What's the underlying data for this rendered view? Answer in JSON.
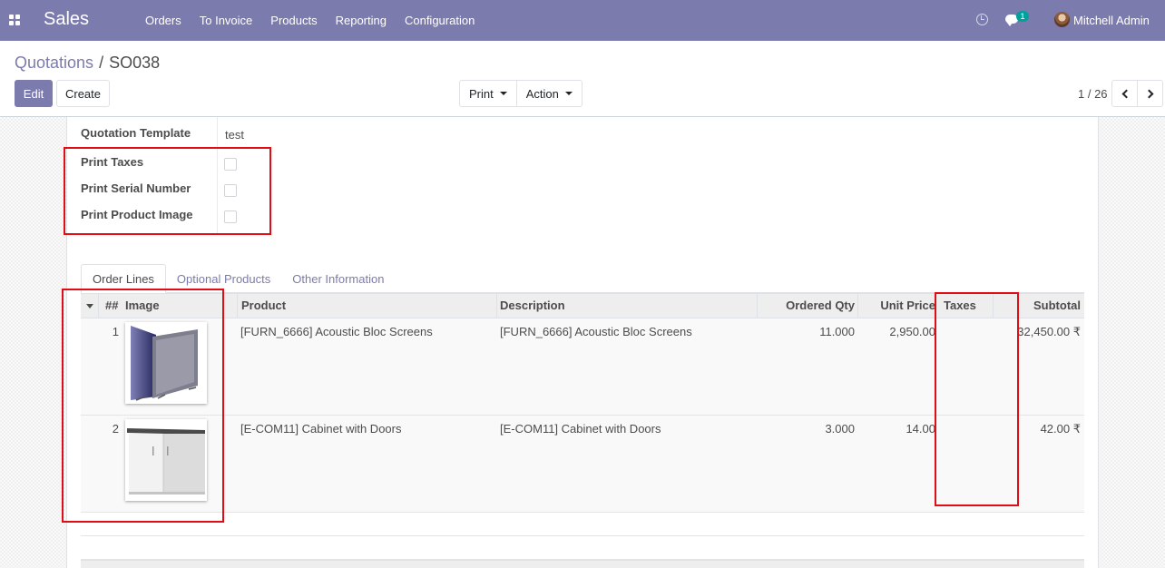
{
  "navbar": {
    "app_name": "Sales",
    "menu": [
      "Orders",
      "To Invoice",
      "Products",
      "Reporting",
      "Configuration"
    ],
    "chat_badge": "1",
    "user_name": "Mitchell Admin",
    "bg_color": "#7c7bad"
  },
  "breadcrumb": {
    "parent": "Quotations",
    "separator": "/",
    "current": "SO038"
  },
  "actions": {
    "edit": "Edit",
    "create": "Create",
    "print": "Print",
    "action": "Action"
  },
  "pager": {
    "value": "1 / 26"
  },
  "fields": [
    {
      "label": "Quotation Template",
      "value": "test"
    },
    {
      "label": "Print Taxes",
      "checked": false
    },
    {
      "label": "Print Serial Number",
      "checked": false
    },
    {
      "label": "Print Product Image",
      "checked": false
    }
  ],
  "tabs": [
    "Order Lines",
    "Optional Products",
    "Other Information"
  ],
  "table": {
    "columns": [
      "##",
      "Image",
      "Product",
      "Description",
      "Ordered Qty",
      "Unit Price",
      "Taxes",
      "Subtotal"
    ],
    "rows": [
      {
        "seq": "1",
        "image": "acoustic-screens",
        "product": "[FURN_6666] Acoustic Bloc Screens",
        "description": "[FURN_6666] Acoustic Bloc Screens",
        "qty": "11.000",
        "price": "2,950.00",
        "taxes": "",
        "subtotal": "32,450.00 ₹"
      },
      {
        "seq": "2",
        "image": "cabinet",
        "product": "[E-COM11] Cabinet with Doors",
        "description": "[E-COM11] Cabinet with Doors",
        "qty": "3.000",
        "price": "14.00",
        "taxes": "",
        "subtotal": "42.00 ₹"
      }
    ]
  },
  "highlight_color": "#e00d15"
}
